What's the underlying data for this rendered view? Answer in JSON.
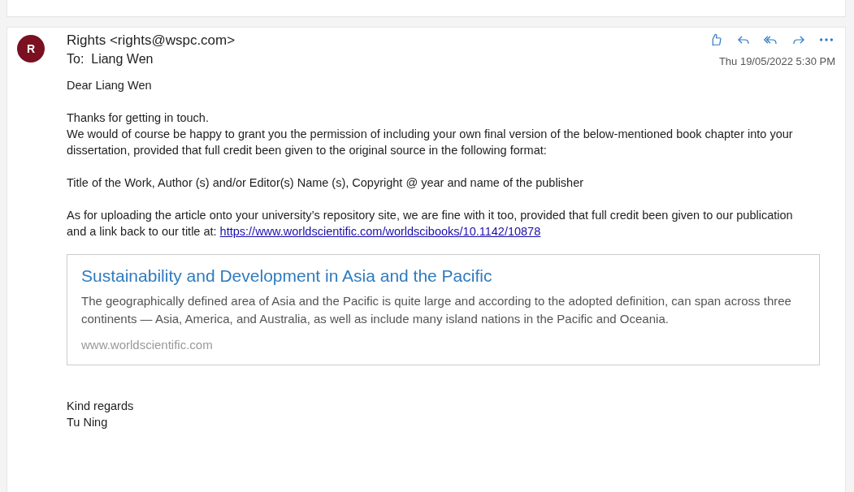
{
  "message": {
    "avatar_initial": "R",
    "sender": "Rights <rights@wspc.com>",
    "to_label": "To:",
    "recipient": "Liang Wen",
    "date": "Thu 19/05/2022 5:30 PM",
    "actions": [
      {
        "kind": "like"
      },
      {
        "kind": "reply"
      },
      {
        "kind": "reply-all"
      },
      {
        "kind": "forward"
      },
      {
        "kind": "more"
      }
    ],
    "body": [
      {
        "kind": "text",
        "lines": [
          "Dear Liang Wen"
        ]
      },
      {
        "kind": "text",
        "lines": [
          "Thanks for getting in touch.",
          "We would of course be happy to grant you the permission of including your own final version of the below-mentioned book chapter into your dissertation, provided that full credit been given to the original source in the following format:"
        ]
      },
      {
        "kind": "text",
        "lines": [
          "Title of the Work, Author (s) and/or Editor(s) Name (s), Copyright @ year and name of the publisher"
        ]
      },
      {
        "kind": "link",
        "text": "As for uploading the article onto your university’s repository site, we are fine with it too, provided that full credit been given to our publication and a link back to our title at:",
        "link": "https://www.worldscientific.com/worldscibooks/10.1142/10878"
      }
    ],
    "preview": {
      "title": "Sustainability and Development in Asia and the Pacific",
      "description": "The geographically defined area of Asia and the Pacific is quite large and according to the adopted definition, can span across three continents — Asia, America, and Australia, as well as include many island nations in the Pacific and Oceania.",
      "site": "www.worldscientific.com"
    },
    "signature": [
      "Kind regards",
      "Tu Ning"
    ]
  }
}
